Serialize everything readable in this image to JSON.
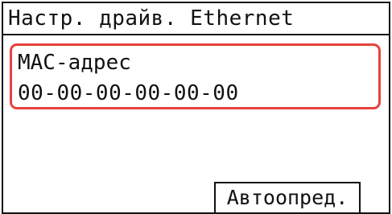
{
  "header": {
    "title": "Настр. драйв. Ethernet"
  },
  "selected_item": {
    "label": "МАС-адрес",
    "value": "00-00-00-00-00-00"
  },
  "footer": {
    "auto_button_label": "Автоопред."
  },
  "colors": {
    "highlight": "#e8423c",
    "border": "#111111",
    "background": "#ffffff"
  }
}
